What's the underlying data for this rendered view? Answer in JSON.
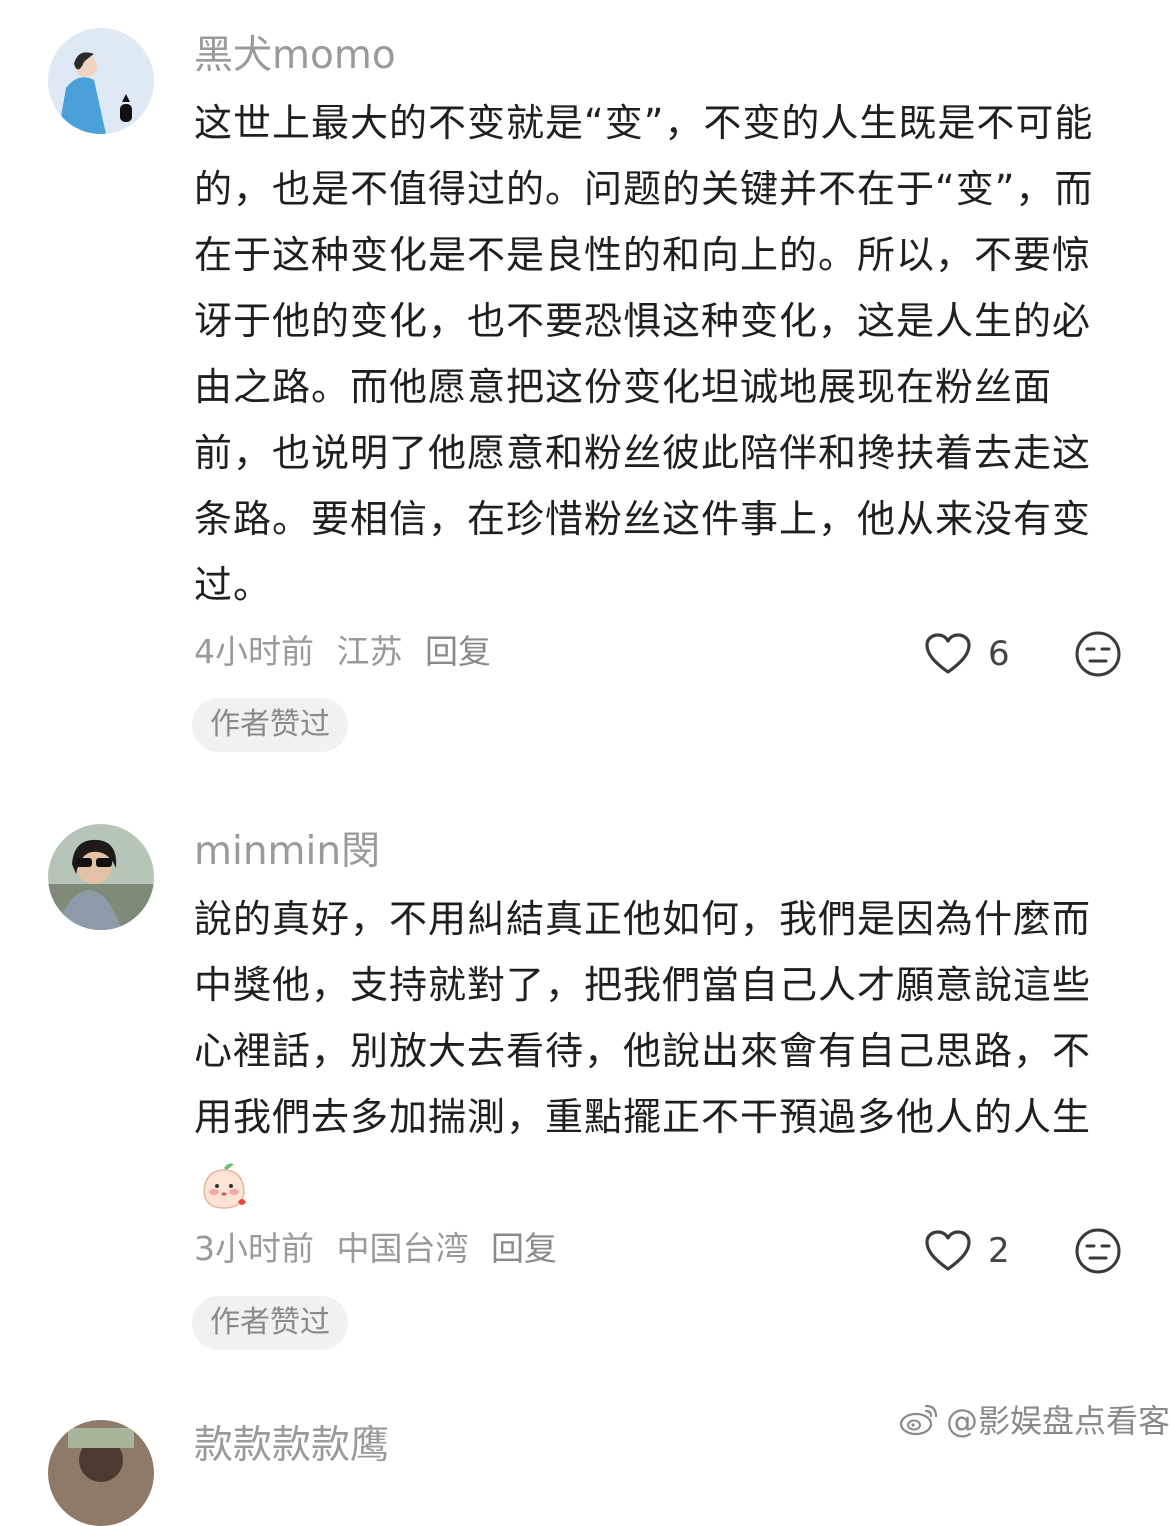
{
  "comments": [
    {
      "username": "黑犬momo",
      "text": "这世上最大的不变就是“变”，不变的人生既是不可能的，也是不值得过的。问题的关键并不在于“变”，而在于这种变化是不是良性的和向上的。所以，不要惊讶于他的变化，也不要恐惧这种变化，这是人生的必由之路。而他愿意把这份变化坦诚地展现在粉丝面前，也说明了他愿意和粉丝彼此陪伴和搀扶着去走这条路。要相信，在珍惜粉丝这件事上，他从来没有变过。",
      "time": "4小时前",
      "location": "江苏",
      "reply_label": "回复",
      "likes": "6",
      "badge": "作者赞过"
    },
    {
      "username": "minmin閔",
      "text": "說的真好，不用糾結真正他如何，我們是因為什麼而中獎他，支持就對了，把我們當自己人才願意說這些心裡話，別放大去看待，他說出來會有自己思路，不用我們去多加揣測，重點擺正不干預過多他人的人生",
      "time": "3小时前",
      "location": "中国台湾",
      "reply_label": "回复",
      "likes": "2",
      "badge": "作者赞过"
    },
    {
      "username": "款款款款鹰"
    }
  ],
  "watermark": "@影娱盘点看客",
  "icons": {
    "like": "heart-outline-icon",
    "dislike": "neutral-face-icon",
    "watermark": "weibo-logo-icon",
    "emoji": "blushing-peach-emoji-icon"
  },
  "colors": {
    "username": "#9a9a9a",
    "text": "#1f1f1f",
    "meta": "#9a9a9a",
    "badge_bg": "#f1f1f1"
  }
}
